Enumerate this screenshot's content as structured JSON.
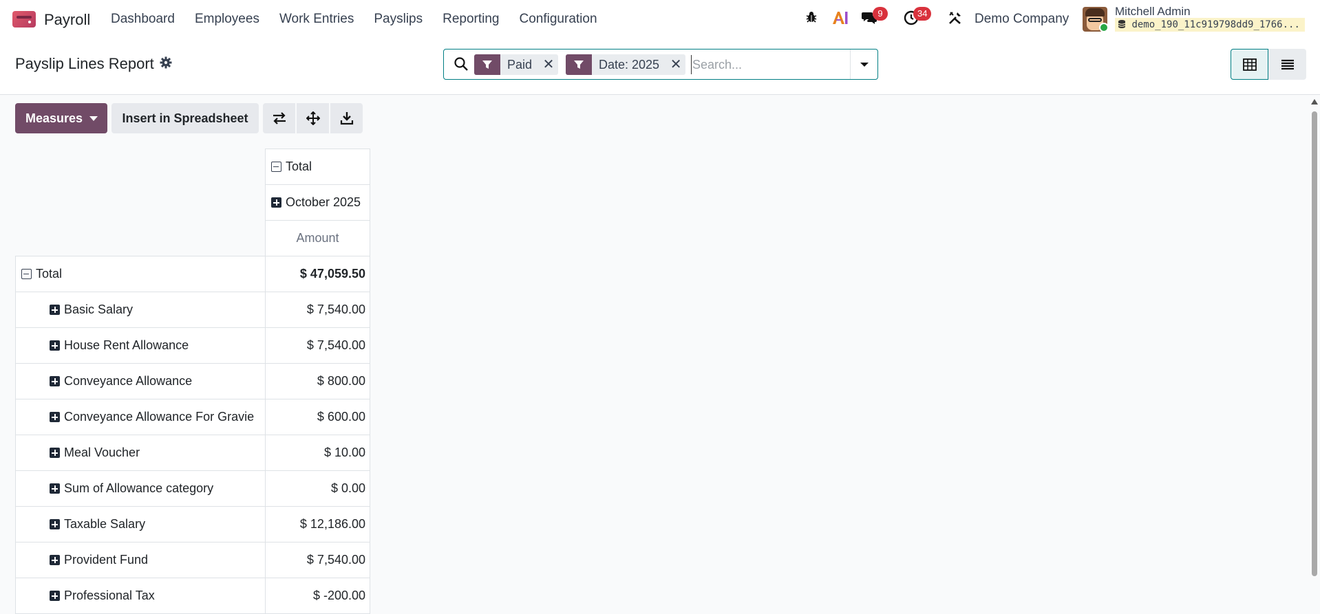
{
  "navbar": {
    "app_name": "Payroll",
    "menu": [
      "Dashboard",
      "Employees",
      "Work Entries",
      "Payslips",
      "Reporting",
      "Configuration"
    ],
    "chat_count": "9",
    "activity_count": "34",
    "company": "Demo Company",
    "user_name": "Mitchell Admin",
    "db_name": "demo_190_11c919798dd9_1766..."
  },
  "control": {
    "title": "Payslip Lines Report",
    "facets": [
      {
        "label": "Paid"
      },
      {
        "label": "Date: 2025"
      }
    ],
    "search_placeholder": "Search..."
  },
  "toolbar": {
    "measures_label": "Measures",
    "insert_label": "Insert in Spreadsheet"
  },
  "pivot": {
    "col_total": "Total",
    "col_period": "October 2025",
    "measure": "Amount",
    "total_label": "Total",
    "total_value": "$ 47,059.50",
    "rows": [
      {
        "label": "Basic Salary",
        "value": "$ 7,540.00"
      },
      {
        "label": "House Rent Allowance",
        "value": "$ 7,540.00"
      },
      {
        "label": "Conveyance Allowance",
        "value": "$ 800.00"
      },
      {
        "label": "Conveyance Allowance For Gravie",
        "value": "$ 600.00"
      },
      {
        "label": "Meal Voucher",
        "value": "$ 10.00"
      },
      {
        "label": "Sum of Allowance category",
        "value": "$ 0.00"
      },
      {
        "label": "Taxable Salary",
        "value": "$ 12,186.00"
      },
      {
        "label": "Provident Fund",
        "value": "$ 7,540.00"
      },
      {
        "label": "Professional Tax",
        "value": "$ -200.00"
      }
    ]
  },
  "colors": {
    "brand": "#714b67",
    "accent": "#017e84",
    "badge": "#d9323d"
  }
}
